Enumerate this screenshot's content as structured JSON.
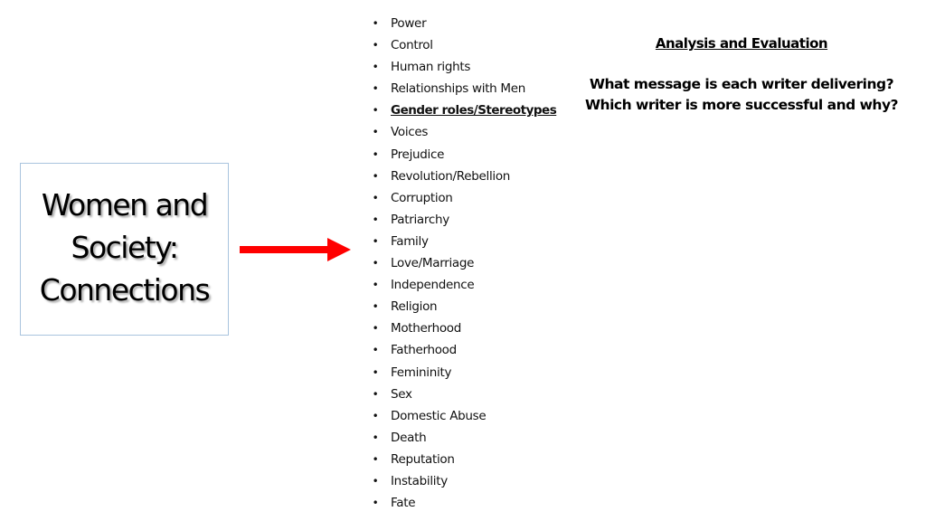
{
  "title_box": {
    "lines": [
      "Women and",
      "Society:",
      "Connections"
    ]
  },
  "arrow": {
    "icon": "right-arrow-icon",
    "color": "#ff0000"
  },
  "topics": {
    "bullet": "•",
    "items": [
      {
        "label": "Power"
      },
      {
        "label": "Control"
      },
      {
        "label": "Human rights"
      },
      {
        "label": "Relationships with Men"
      },
      {
        "label": "Gender roles/Stereotypes",
        "emphasized": true
      },
      {
        "label": "Voices"
      },
      {
        "label": "Prejudice"
      },
      {
        "label": "Revolution/Rebellion"
      },
      {
        "label": "Corruption"
      },
      {
        "label": "Patriarchy"
      },
      {
        "label": "Family"
      },
      {
        "label": "Love/Marriage"
      },
      {
        "label": "Independence"
      },
      {
        "label": "Religion"
      },
      {
        "label": "Motherhood"
      },
      {
        "label": "Fatherhood"
      },
      {
        "label": "Femininity"
      },
      {
        "label": "Sex"
      },
      {
        "label": "Domestic Abuse"
      },
      {
        "label": "Death"
      },
      {
        "label": "Reputation"
      },
      {
        "label": "Instability"
      },
      {
        "label": "Fate"
      }
    ]
  },
  "analysis": {
    "heading": "Analysis and Evaluation",
    "questions": [
      "What message is each writer delivering?",
      "Which writer is more successful and why?"
    ]
  }
}
